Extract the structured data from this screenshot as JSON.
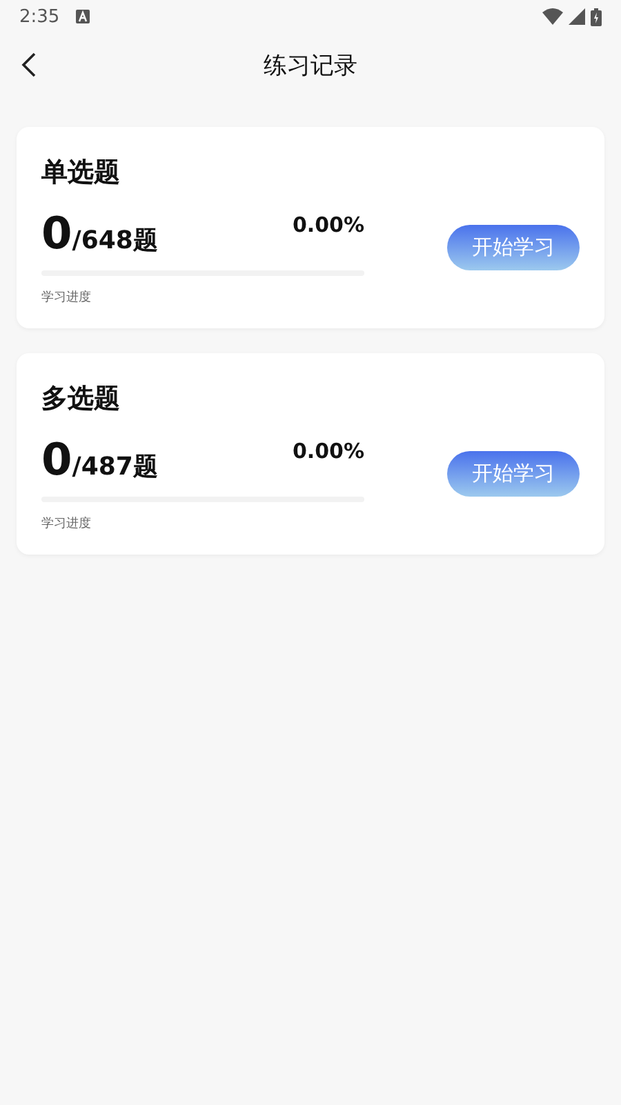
{
  "status_bar": {
    "time": "2:35"
  },
  "header": {
    "title": "练习记录"
  },
  "cards": [
    {
      "title": "单选题",
      "done": "0",
      "total": "/648题",
      "percent": "0.00%",
      "level": 0,
      "caption": "学习进度",
      "button": "开始学习"
    },
    {
      "title": "多选题",
      "done": "0",
      "total": "/487题",
      "percent": "0.00%",
      "level": 0,
      "caption": "学习进度",
      "button": "开始学习"
    }
  ]
}
